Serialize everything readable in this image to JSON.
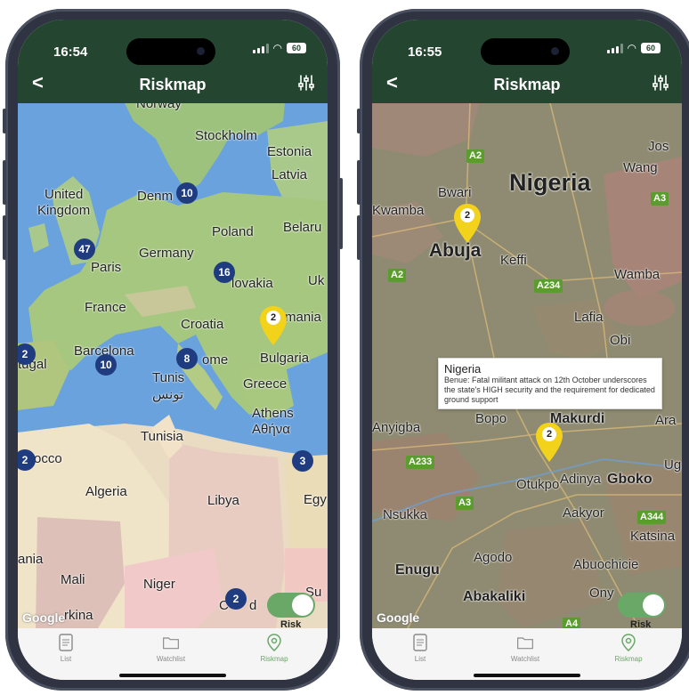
{
  "left": {
    "time": "16:54",
    "battery": "60",
    "title": "Riskmap",
    "labels": [
      {
        "text": "Norway"
      },
      {
        "text": "Stockholm"
      },
      {
        "text": "Estonia"
      },
      {
        "text": "Latvia"
      },
      {
        "text": "United"
      },
      {
        "text": "Kingdom"
      },
      {
        "text": "Denm"
      },
      {
        "text": "Poland"
      },
      {
        "text": "Belaru"
      },
      {
        "text": "Germany"
      },
      {
        "text": "Paris"
      },
      {
        "text": "lovakia"
      },
      {
        "text": "Uk"
      },
      {
        "text": "France"
      },
      {
        "text": "Croatia"
      },
      {
        "text": "mania"
      },
      {
        "text": "Bulgaria"
      },
      {
        "text": "Barcelona"
      },
      {
        "text": "tugal"
      },
      {
        "text": "ome"
      },
      {
        "text": "Tunis"
      },
      {
        "text": "تونس"
      },
      {
        "text": "Greece"
      },
      {
        "text": "Athens"
      },
      {
        "text": "Αθήνα"
      },
      {
        "text": "Tunisia"
      },
      {
        "text": "occo"
      },
      {
        "text": "Algeria"
      },
      {
        "text": "Libya"
      },
      {
        "text": "Egy"
      },
      {
        "text": "ania"
      },
      {
        "text": "Mali"
      },
      {
        "text": "Niger"
      },
      {
        "text": "C"
      },
      {
        "text": "d"
      },
      {
        "text": "Su"
      },
      {
        "text": "rkina"
      }
    ],
    "clusters": [
      {
        "count": "10"
      },
      {
        "count": "47"
      },
      {
        "count": "16"
      },
      {
        "count": "2"
      },
      {
        "count": "10"
      },
      {
        "count": "8"
      },
      {
        "count": "2"
      },
      {
        "count": "3"
      },
      {
        "count": "2"
      }
    ],
    "pin_count": "2",
    "google": "Google",
    "toggle_label": "Risk",
    "tabs": [
      {
        "label": "List"
      },
      {
        "label": "Watchlist"
      },
      {
        "label": "Riskmap"
      }
    ]
  },
  "right": {
    "time": "16:55",
    "battery": "60",
    "title": "Riskmap",
    "labels": [
      {
        "text": "Jos"
      },
      {
        "text": "Wang"
      },
      {
        "text": "Nigeria"
      },
      {
        "text": "Bwari"
      },
      {
        "text": "Kwamba"
      },
      {
        "text": "Abuja"
      },
      {
        "text": "Keffi"
      },
      {
        "text": "Wamba"
      },
      {
        "text": "Lafia"
      },
      {
        "text": "Obi"
      },
      {
        "text": "Anyigba"
      },
      {
        "text": "Bopo"
      },
      {
        "text": "Makurdi"
      },
      {
        "text": "Ara"
      },
      {
        "text": "Ug"
      },
      {
        "text": "Otukpo"
      },
      {
        "text": "Adinya"
      },
      {
        "text": "Gboko"
      },
      {
        "text": "Nsukka"
      },
      {
        "text": "Aakyor"
      },
      {
        "text": "Katsina"
      },
      {
        "text": "Agodo"
      },
      {
        "text": "Enugu"
      },
      {
        "text": "Abuochicie"
      },
      {
        "text": "Abakaliki"
      },
      {
        "text": "Ony"
      }
    ],
    "roads": [
      {
        "text": "A2"
      },
      {
        "text": "A3"
      },
      {
        "text": "A2"
      },
      {
        "text": "A234"
      },
      {
        "text": "A233"
      },
      {
        "text": "A3"
      },
      {
        "text": "A344"
      },
      {
        "text": "A4"
      }
    ],
    "pins": [
      {
        "count": "2"
      },
      {
        "count": "2"
      }
    ],
    "tooltip": {
      "title": "Nigeria",
      "body": "Benue: Fatal militant attack on 12th October underscores the state's HIGH security and the requirement for dedicated ground support"
    },
    "google": "Google",
    "toggle_label": "Risk",
    "tabs": [
      {
        "label": "List"
      },
      {
        "label": "Watchlist"
      },
      {
        "label": "Riskmap"
      }
    ]
  },
  "colors": {
    "header": "#24452f",
    "cluster": "#1f3c80",
    "pin": "#f2d21a",
    "active_tab": "#6aa868"
  }
}
